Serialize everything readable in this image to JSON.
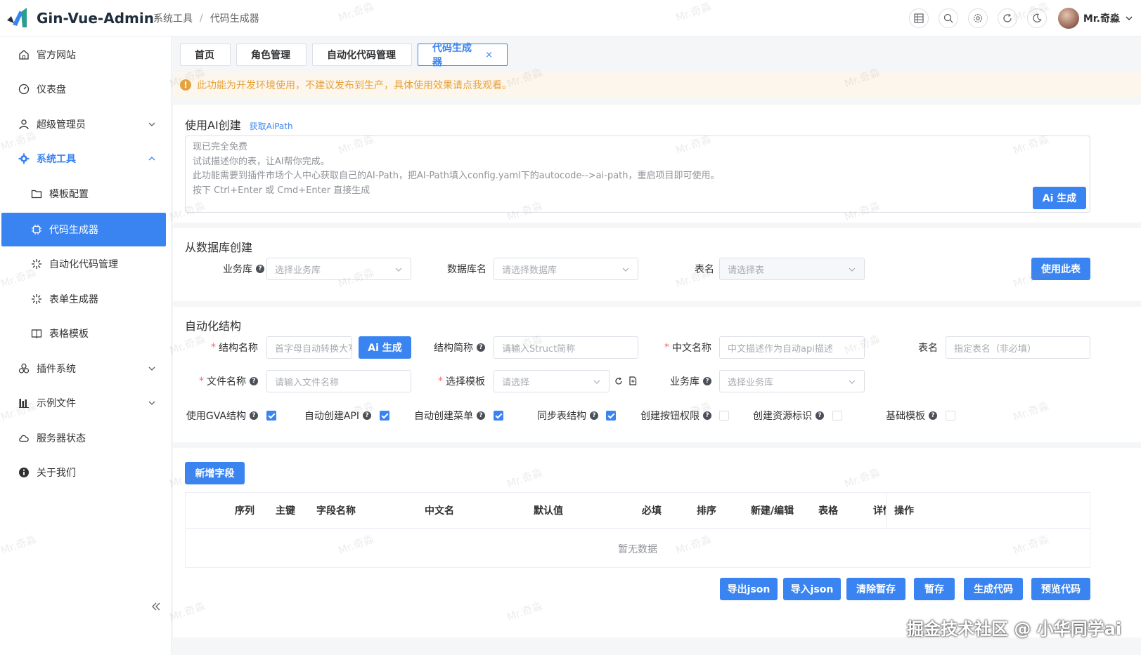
{
  "header": {
    "app_title": "Gin-Vue-Admin",
    "breadcrumb": [
      "系统工具",
      "代码生成器"
    ],
    "breadcrumb_sep": "/",
    "username": "Mr.奇淼",
    "icons": [
      "table-icon",
      "search-icon",
      "settings-icon",
      "refresh-icon",
      "moon-icon"
    ]
  },
  "sidebar": {
    "items": [
      {
        "label": "官方网站",
        "icon": "home-icon"
      },
      {
        "label": "仪表盘",
        "icon": "gauge-icon"
      },
      {
        "label": "超级管理员",
        "icon": "user-icon"
      },
      {
        "label": "系统工具",
        "icon": "gear-icon"
      },
      {
        "label": "模板配置",
        "icon": "folder-icon"
      },
      {
        "label": "代码生成器",
        "icon": "cpu-icon"
      },
      {
        "label": "自动化代码管理",
        "icon": "sparkle-icon"
      },
      {
        "label": "表单生成器",
        "icon": "sparkle-icon"
      },
      {
        "label": "表格模板",
        "icon": "book-icon"
      },
      {
        "label": "插件系统",
        "icon": "apps-icon"
      },
      {
        "label": "示例文件",
        "icon": "chart-icon"
      },
      {
        "label": "服务器状态",
        "icon": "cloud-icon"
      },
      {
        "label": "关于我们",
        "icon": "info-icon"
      }
    ]
  },
  "tabs": [
    {
      "label": "首页"
    },
    {
      "label": "角色管理"
    },
    {
      "label": "自动化代码管理"
    },
    {
      "label": "代码生成器",
      "close": "×"
    }
  ],
  "alert": "此功能为开发环境使用，不建议发布到生产，具体使用效果请点我观看。",
  "ai": {
    "title": "使用AI创建",
    "link": "获取AiPath",
    "placeholder_lines": [
      "现已完全免费",
      "试试描述你的表，让AI帮你完成。",
      "此功能需要到插件市场个人中心获取自己的AI-Path，把AI-Path填入config.yaml下的autocode-->ai-path，重启项目即可使用。",
      "按下 Ctrl+Enter 或 Cmd+Enter 直接生成"
    ],
    "button": "Ai 生成"
  },
  "db": {
    "title": "从数据库创建",
    "business_label": "业务库",
    "business_placeholder": "选择业务库",
    "dbname_label": "数据库名",
    "dbname_placeholder": "请选择数据库",
    "table_label": "表名",
    "table_placeholder": "请选择表",
    "use_button": "使用此表"
  },
  "auto": {
    "title": "自动化结构",
    "struct_name_label": "结构名称",
    "struct_name_placeholder": "首字母自动转换大写",
    "ai_button": "Ai 生成",
    "struct_abbr_label": "结构简称",
    "struct_abbr_placeholder": "请输入Struct简称",
    "cn_name_label": "中文名称",
    "cn_name_placeholder": "中文描述作为自动api描述",
    "table_label": "表名",
    "table_placeholder": "指定表名（非必填）",
    "file_name_label": "文件名称",
    "file_name_placeholder": "请输入文件名称",
    "template_label": "选择模板",
    "template_placeholder": "请选择",
    "business_label": "业务库",
    "business_placeholder": "选择业务库",
    "checks": [
      {
        "label": "使用GVA结构",
        "checked": true
      },
      {
        "label": "自动创建API",
        "checked": true
      },
      {
        "label": "自动创建菜单",
        "checked": true
      },
      {
        "label": "同步表结构",
        "checked": true
      },
      {
        "label": "创建按钮权限",
        "checked": false
      },
      {
        "label": "创建资源标识",
        "checked": false
      },
      {
        "label": "基础模板",
        "checked": false
      }
    ]
  },
  "fields": {
    "add_button": "新增字段",
    "columns": [
      "序列",
      "主键",
      "字段名称",
      "中文名",
      "默认值",
      "必填",
      "排序",
      "新建/编辑",
      "表格",
      "详情",
      "操作"
    ],
    "empty_text": "暂无数据"
  },
  "actions": [
    "导出json",
    "导入json",
    "清除暂存",
    "暂存",
    "生成代码",
    "预览代码"
  ],
  "watermark": "Mr.奇淼",
  "footer_caption": "掘金技术社区 @ 小华同学ai",
  "colors": {
    "primary": "#3a84f1",
    "warning": "#e6a23c",
    "warning_bg": "#fdf6ec"
  }
}
